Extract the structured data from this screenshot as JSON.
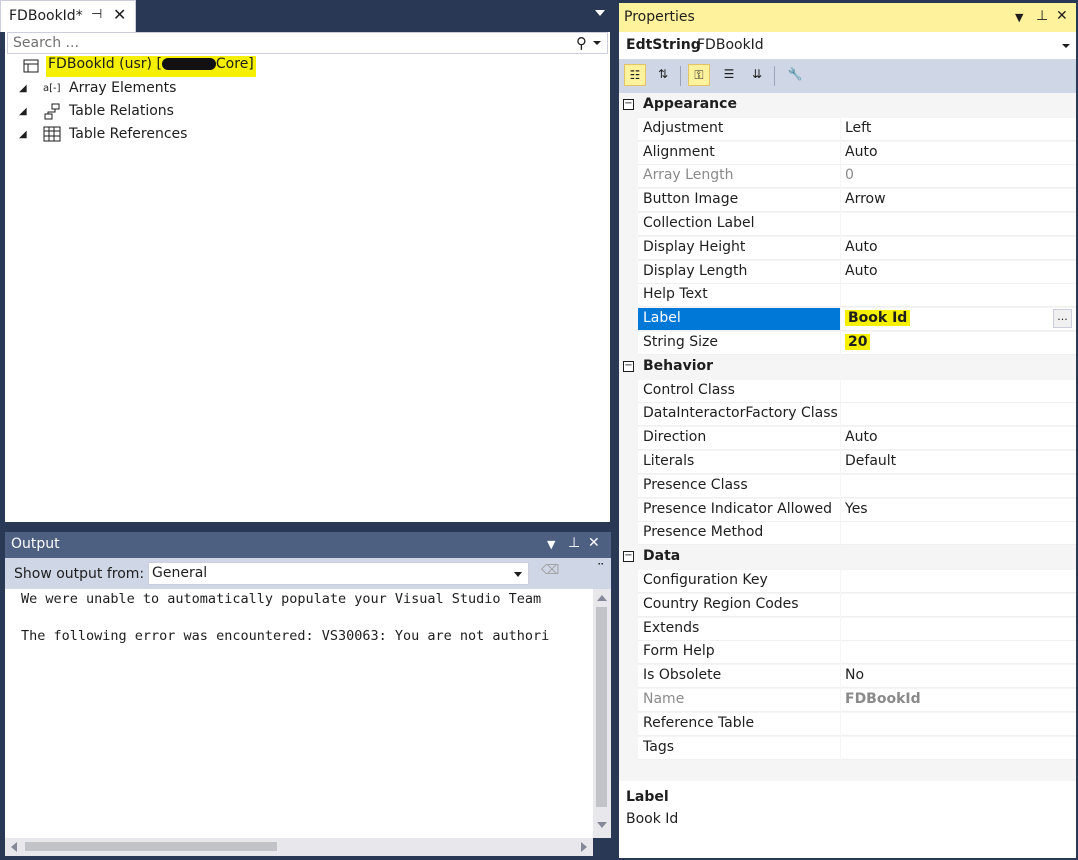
{
  "solution_tab": {
    "title": "FDBookId*",
    "pin_icon": "pin-icon",
    "close_icon": "close-icon"
  },
  "search": {
    "placeholder": "Search ..."
  },
  "tree": {
    "root": {
      "label_prefix": "FDBookId (usr) [",
      "label_suffix": "Core]"
    },
    "items": [
      {
        "label": "Array Elements"
      },
      {
        "label": "Table Relations"
      },
      {
        "label": "Table References"
      }
    ]
  },
  "output": {
    "title": "Output",
    "show_from_label": "Show output from:",
    "source": "General",
    "lines": [
      "We were unable to automatically populate your Visual Studio Team",
      "The following error was encountered: VS30063: You are not authori"
    ]
  },
  "properties": {
    "title": "Properties",
    "object_type": "EdtString",
    "object_name": "FDBookId",
    "categories": [
      {
        "name": "Appearance",
        "rows": [
          {
            "key": "Adjustment",
            "value": "Left"
          },
          {
            "key": "Alignment",
            "value": "Auto"
          },
          {
            "key": "Array Length",
            "value": "0",
            "disabled": true
          },
          {
            "key": "Button Image",
            "value": "Arrow"
          },
          {
            "key": "Collection Label",
            "value": ""
          },
          {
            "key": "Display Height",
            "value": "Auto"
          },
          {
            "key": "Display Length",
            "value": "Auto"
          },
          {
            "key": "Help Text",
            "value": ""
          },
          {
            "key": "Label",
            "value": "Book Id",
            "selected": true,
            "highlight": true
          },
          {
            "key": "String Size",
            "value": "20",
            "highlight": true
          }
        ]
      },
      {
        "name": "Behavior",
        "rows": [
          {
            "key": "Control Class",
            "value": ""
          },
          {
            "key": "DataInteractorFactory Class",
            "value": ""
          },
          {
            "key": "Direction",
            "value": "Auto"
          },
          {
            "key": "Literals",
            "value": "Default"
          },
          {
            "key": "Presence Class",
            "value": ""
          },
          {
            "key": "Presence Indicator Allowed",
            "value": "Yes"
          },
          {
            "key": "Presence Method",
            "value": ""
          }
        ]
      },
      {
        "name": "Data",
        "rows": [
          {
            "key": "Configuration Key",
            "value": ""
          },
          {
            "key": "Country Region Codes",
            "value": ""
          },
          {
            "key": "Extends",
            "value": ""
          },
          {
            "key": "Form Help",
            "value": ""
          },
          {
            "key": "Is Obsolete",
            "value": "No"
          },
          {
            "key": "Name",
            "value": "FDBookId",
            "disabled": true,
            "bold": true
          },
          {
            "key": "Reference Table",
            "value": ""
          },
          {
            "key": "Tags",
            "value": ""
          }
        ]
      }
    ],
    "description": {
      "title": "Label",
      "text": "Book Id"
    }
  },
  "colors": {
    "accent_selected": "#0078d7",
    "highlight_marker": "#f5f000",
    "active_title": "#fff29d",
    "chrome": "#293955"
  }
}
